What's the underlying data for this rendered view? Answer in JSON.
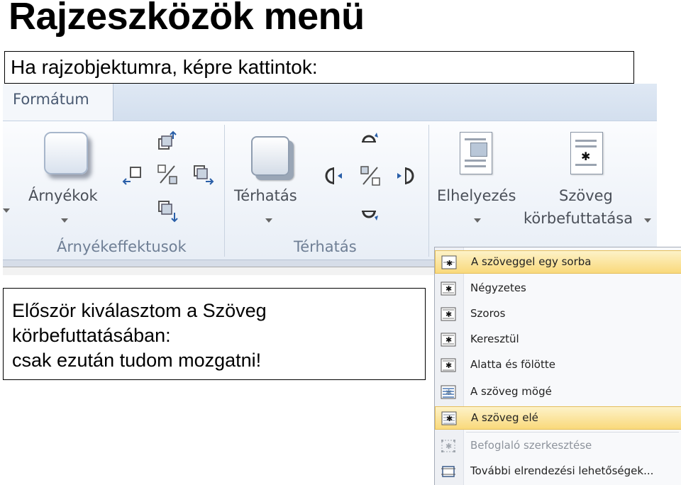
{
  "title": "Rajzeszközök menü",
  "caption_top": "Ha rajzobjektumra, képre kattintok:",
  "ribbon": {
    "tab": "Formátum",
    "groups": {
      "shadow": {
        "button_label": "Árnyékok",
        "group_label": "Árnyékeffektusok"
      },
      "threed": {
        "button_label": "Térhatás",
        "group_label": "Térhatás"
      },
      "arrange": {
        "position_label": "Elhelyezés",
        "wrap_label_line1": "Szöveg",
        "wrap_label_line2": "körbefuttatása"
      }
    }
  },
  "caption_bottom": {
    "line1": "Először kiválasztom a Szöveg",
    "line2": "körbefuttatásában:",
    "line3": "csak ezután tudom mozgatni!"
  },
  "wrap_menu": {
    "items": [
      {
        "label": "A szöveggel egy sorba",
        "icon": "inline-wrap-icon",
        "state": "active"
      },
      {
        "label": "Négyzetes",
        "icon": "square-wrap-icon",
        "state": "normal"
      },
      {
        "label": "Szoros",
        "icon": "tight-wrap-icon",
        "state": "normal"
      },
      {
        "label": "Keresztül",
        "icon": "through-wrap-icon",
        "state": "normal"
      },
      {
        "label": "Alatta és fölötte",
        "icon": "top-bottom-wrap-icon",
        "state": "normal"
      },
      {
        "label": "A szöveg mögé",
        "icon": "behind-text-icon",
        "state": "normal"
      },
      {
        "label": "A szöveg elé",
        "icon": "in-front-text-icon",
        "state": "hover"
      },
      {
        "label": "Befoglaló szerkesztése",
        "icon": "edit-wrap-points-icon",
        "state": "disabled"
      },
      {
        "label": "További elrendezési lehetőségek...",
        "icon": "more-layout-icon",
        "state": "normal"
      }
    ]
  },
  "colors": {
    "ribbon_bg": "#eef2f8",
    "highlight": "#f9d97b",
    "group_label": "#6f7f95"
  }
}
